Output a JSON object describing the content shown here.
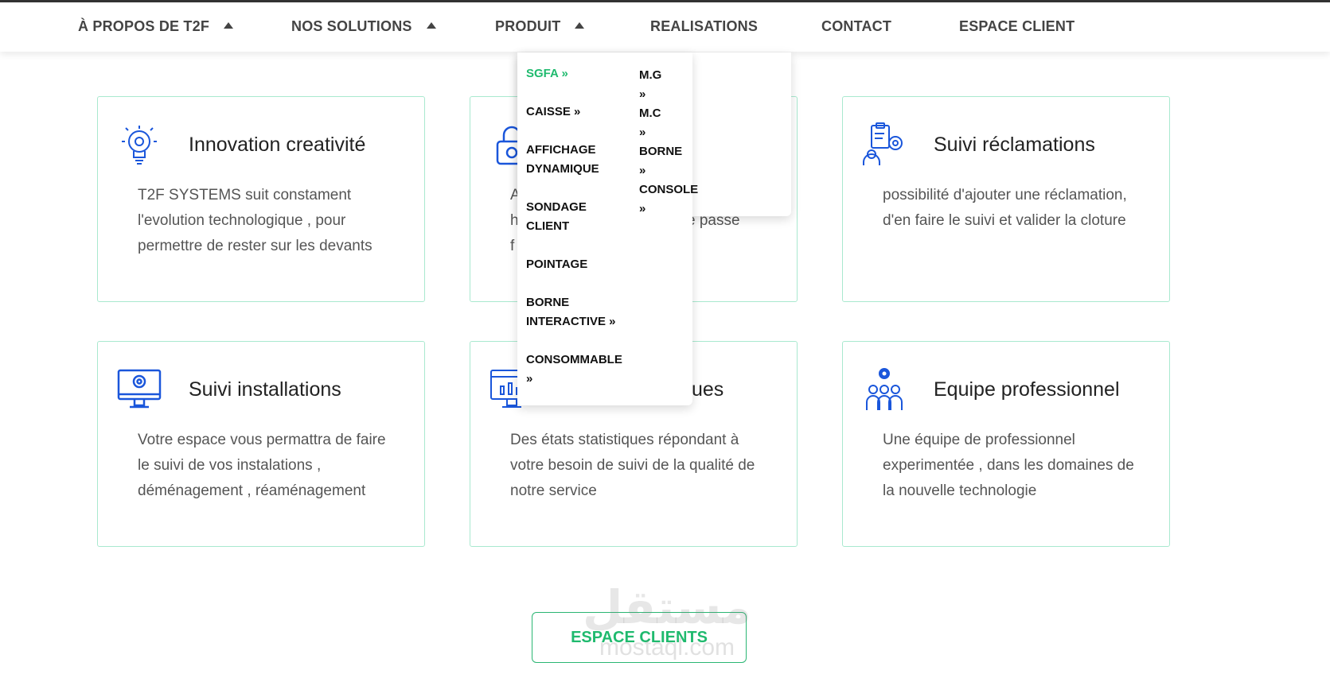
{
  "nav": {
    "items": [
      {
        "label": "À PROPOS DE T2F",
        "has_caret": true
      },
      {
        "label": "NOS SOLUTIONS",
        "has_caret": true
      },
      {
        "label": "PRODUIT",
        "has_caret": true
      },
      {
        "label": "REALISATIONS",
        "has_caret": false
      },
      {
        "label": "CONTACT",
        "has_caret": false
      },
      {
        "label": "ESPACE CLIENT",
        "has_caret": false
      }
    ]
  },
  "dropdown": {
    "left_column": [
      {
        "label": "SGFA »",
        "active": true
      },
      {
        "label": "CAISSE »"
      },
      {
        "label": "AFFICHAGE DYNAMIQUE"
      },
      {
        "label": "SONDAGE CLIENT"
      },
      {
        "label": "POINTAGE"
      },
      {
        "label": "BORNE INTERACTIVE »"
      },
      {
        "label": "CONSOMMABLE »"
      }
    ],
    "right_column": [
      {
        "label": "M.G »"
      },
      {
        "label": "M.C »"
      },
      {
        "label": "BORNE »"
      },
      {
        "label": "CONSOLE »"
      }
    ]
  },
  "cards": [
    {
      "icon": "lightbulb-icon",
      "title": "Innovation creativité",
      "text": "T2F SYSTEMS suit constament l'evolution technologique , pour permettre de rester sur les devants"
    },
    {
      "icon": "padlock-icon",
      "title": "",
      "text_fragments": [
        "A",
        "h",
        "f"
      ],
      "text_tail": "e passe"
    },
    {
      "icon": "clipboard-gear-user-icon",
      "title": "Suivi réclamations",
      "text": "possibilité d'ajouter une réclamation, d'en faire le suivi et valider la cloture"
    },
    {
      "icon": "monitor-gear-icon",
      "title": "Suivi installations",
      "text": "Votre espace vous permattra de faire le suivi de vos instalations , déménagement , réaménagement"
    },
    {
      "icon": "monitor-chart-icon",
      "title": "ues",
      "text": "Des états statistiques répondant à votre besoin de suivi de la qualité de notre service"
    },
    {
      "icon": "team-gear-icon",
      "title": "Equipe professionnel",
      "text": "Une équipe de professionnel experimentée , dans les domaines de la nouvelle technologie"
    }
  ],
  "cta": {
    "label": "ESPACE CLIENTS"
  },
  "watermark": {
    "arabic": "مستقل",
    "latin": "mostaql.com"
  },
  "colors": {
    "accent": "#1fba6e",
    "icon_blue": "#1a56db",
    "card_border": "#a9e9cf"
  }
}
